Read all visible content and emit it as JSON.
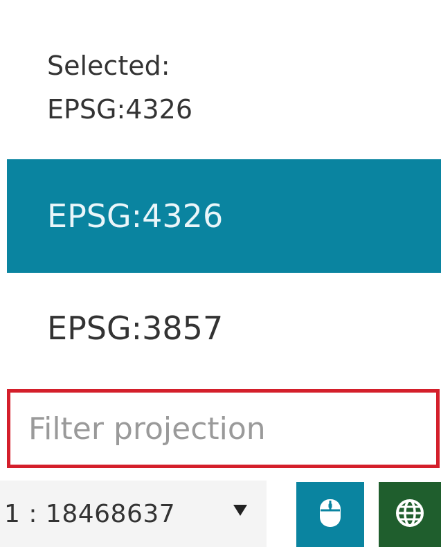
{
  "dropdown": {
    "selected_label": "Selected:",
    "selected_value": "EPSG:4326",
    "options": [
      {
        "label": "EPSG:4326",
        "active": true
      },
      {
        "label": "EPSG:3857",
        "active": false
      }
    ]
  },
  "filter": {
    "placeholder": "Filter projection",
    "value": ""
  },
  "bottom_bar": {
    "scale_value": "1 : 18468637",
    "caret_icon": "triangle-down-icon",
    "mouse_button_icon": "mouse-icon",
    "globe_button_icon": "globe-icon"
  },
  "colors": {
    "accent": "#0a84a0",
    "highlight_border": "#d41f2b",
    "globe_button": "#1f5e2d"
  }
}
